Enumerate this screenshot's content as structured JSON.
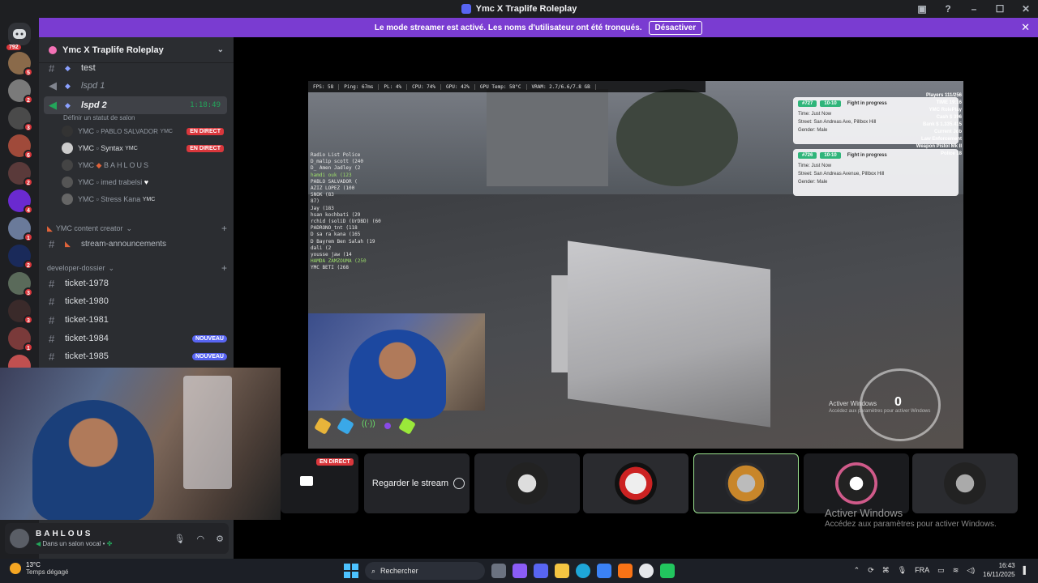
{
  "window": {
    "title": "Ymc X Traplife Roleplay"
  },
  "banner": {
    "text": "Le mode streamer est activé. Les noms d'utilisateur ont été tronqués.",
    "button": "Désactiver"
  },
  "servers": {
    "home_badge": "792",
    "badges": [
      "5",
      "2",
      "3",
      "6",
      "2",
      "4",
      "1",
      "2",
      "3",
      "3",
      "1",
      "6"
    ]
  },
  "guild": {
    "name": "Ymc X Traplife Roleplay"
  },
  "channels": [
    {
      "name": "test",
      "type": "text"
    },
    {
      "name": "lspd 1",
      "type": "voice"
    },
    {
      "name": "lspd 2",
      "type": "voice",
      "timer": "1:18:49",
      "status": "Définir un statut de salon"
    }
  ],
  "voice_users": [
    {
      "prefix": "YMC",
      "name": "PABLO SALVADOR",
      "tag": "YMC",
      "live": "EN DIRECT"
    },
    {
      "prefix": "YMC",
      "name": "Syntax",
      "tag": "YMC",
      "live": "EN DIRECT"
    },
    {
      "prefix": "YMC",
      "name": "BAHLOUS",
      "tag": "",
      "live": ""
    },
    {
      "prefix": "YMC",
      "name": "imed trabelsi",
      "tag": "",
      "live": ""
    },
    {
      "prefix": "YMC",
      "name": "Stress Kana",
      "tag": "YMC",
      "live": ""
    }
  ],
  "categories": [
    {
      "label": "YMC content creator"
    },
    {
      "label": "developer-dossier"
    }
  ],
  "announce_channel": "stream-announcements",
  "tickets": [
    {
      "name": "ticket-1978",
      "badge": ""
    },
    {
      "name": "ticket-1980",
      "badge": ""
    },
    {
      "name": "ticket-1981",
      "badge": ""
    },
    {
      "name": "ticket-1984",
      "badge": "NOUVEAU"
    },
    {
      "name": "ticket-1985",
      "badge": "NOUVEAU"
    }
  ],
  "user_panel": {
    "name": "BAHLOUS",
    "status": "Dans un salon vocal"
  },
  "game_hud": {
    "fps": "FPS: 58",
    "ping": "Ping: 67ms",
    "pl": "PL: 4%",
    "cpu": "CPU: 74%",
    "gpu": "GPU: 42%",
    "gpu_temp": "GPU Temp: 58°C",
    "vram": "VRAM: 2.7/6.6/7.8 GB",
    "radio_title": "Radio List Police",
    "radio_list": [
      "D_malip scott (240",
      "D_ Amen Jadley (2",
      "hamdi ouk (123",
      "PABLO SALVADOR (",
      "AZIZ LOPEZ (100",
      "SNOK (83",
      "87)",
      "Jay (183",
      "hsan kochbati (29",
      "rchid (soliD (UrDBD) (60",
      "PADRONO_tnt (118",
      "D sa ra kana (165",
      "D Bayrem Ben Salah (19",
      "dali (2",
      "yousse jaw (14",
      "HAMDA ZAMZOUMA (250",
      "YMC BETI (268"
    ],
    "notif1": {
      "tag1": "#727",
      "tag2": "10-10",
      "title": "Fight in progress",
      "time": "Time: Just Now",
      "street": "Street: San Andreas Ave, Pillbox Hill",
      "gender": "Gender: Male"
    },
    "notif2": {
      "tag1": "#726",
      "tag2": "10-10",
      "title": "Fight in progress",
      "time": "Time: Just Now",
      "street": "Street: San Andreas Avenue, Pillbox Hill",
      "gender": "Gender: Male"
    },
    "side": [
      "Players 111/256",
      "TIME 19:16",
      "YMC RolePlay",
      "Cash $ 396",
      "Bank $ 1.335.415",
      "Current Job",
      "Law Enforcement",
      "Weapon Pistol Mk II",
      "Police 18"
    ],
    "speed": "0",
    "activate_title": "Activer Windows",
    "activate_sub": "Accédez aux paramètres pour activer Windows"
  },
  "tiles": {
    "live": "EN DIRECT",
    "watch": "Regarder le stream"
  },
  "activate": {
    "title": "Activer Windows",
    "sub": "Accédez aux paramètres pour activer Windows."
  },
  "taskbar": {
    "temp": "13°C",
    "weather": "Temps dégagé",
    "search": "Rechercher",
    "lang": "FRA",
    "time": "16:43",
    "date": "16/11/2025"
  }
}
